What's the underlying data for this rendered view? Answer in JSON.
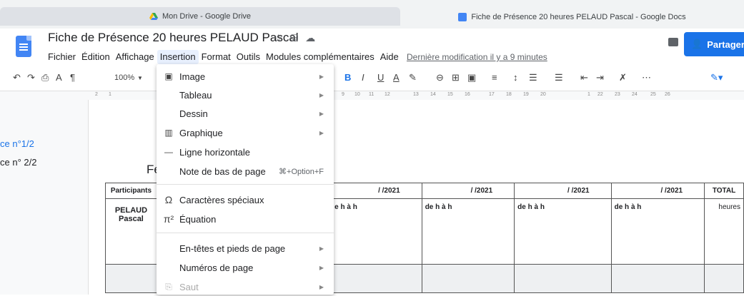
{
  "browser": {
    "tabs": [
      {
        "label": "Mon Drive - Google Drive"
      },
      {
        "label": "Fiche de Présence 20 heures PELAUD Pascal - Google Docs"
      }
    ]
  },
  "doc": {
    "title": "Fiche de Présence 20 heures PELAUD Pascal",
    "last_modified": "Dernière modification il y a 9 minutes",
    "share_label": "Partager"
  },
  "menubar": [
    "Fichier",
    "Édition",
    "Affichage",
    "Insertion",
    "Format",
    "Outils",
    "Modules complémentaires",
    "Aide"
  ],
  "toolbar": {
    "zoom": "100%"
  },
  "ruler": [
    "2",
    "1",
    "9",
    "10",
    "11",
    "12",
    "13",
    "14",
    "15",
    "16",
    "17",
    "18",
    "19",
    "20",
    "1",
    "22",
    "23",
    "24",
    "25",
    "26"
  ],
  "outline": {
    "item1": "ce n°1/2",
    "item2": "ce n° 2/2"
  },
  "page": {
    "heading_fragment": "Fe"
  },
  "table": {
    "headers": [
      "Participants",
      "",
      "/      /2021",
      "/      /2021",
      "/      /2021",
      "/      /2021",
      "TOTAL"
    ],
    "participant": "PELAUD Pascal",
    "slot_partial": "e      h      à      h",
    "slot": "de      h      à      h",
    "total": "heures"
  },
  "insert_menu": {
    "items": [
      {
        "icon": "image-icon",
        "label": "Image",
        "submenu": true
      },
      {
        "icon": "",
        "label": "Tableau",
        "submenu": true
      },
      {
        "icon": "",
        "label": "Dessin",
        "submenu": true
      },
      {
        "icon": "chart-icon",
        "label": "Graphique",
        "submenu": true
      },
      {
        "icon": "hr-icon",
        "label": "Ligne horizontale",
        "submenu": false
      },
      {
        "icon": "",
        "label": "Note de bas de page",
        "shortcut": "⌘+Option+F"
      },
      {
        "icon": "omega-icon",
        "label": "Caractères spéciaux",
        "submenu": false
      },
      {
        "icon": "pi-icon",
        "label": "Équation",
        "submenu": false
      },
      {
        "icon": "",
        "label": "En-têtes et pieds de page",
        "submenu": true
      },
      {
        "icon": "",
        "label": "Numéros de page",
        "submenu": true
      },
      {
        "icon": "break-icon",
        "label": "Saut",
        "submenu": true,
        "disabled": true
      }
    ]
  }
}
